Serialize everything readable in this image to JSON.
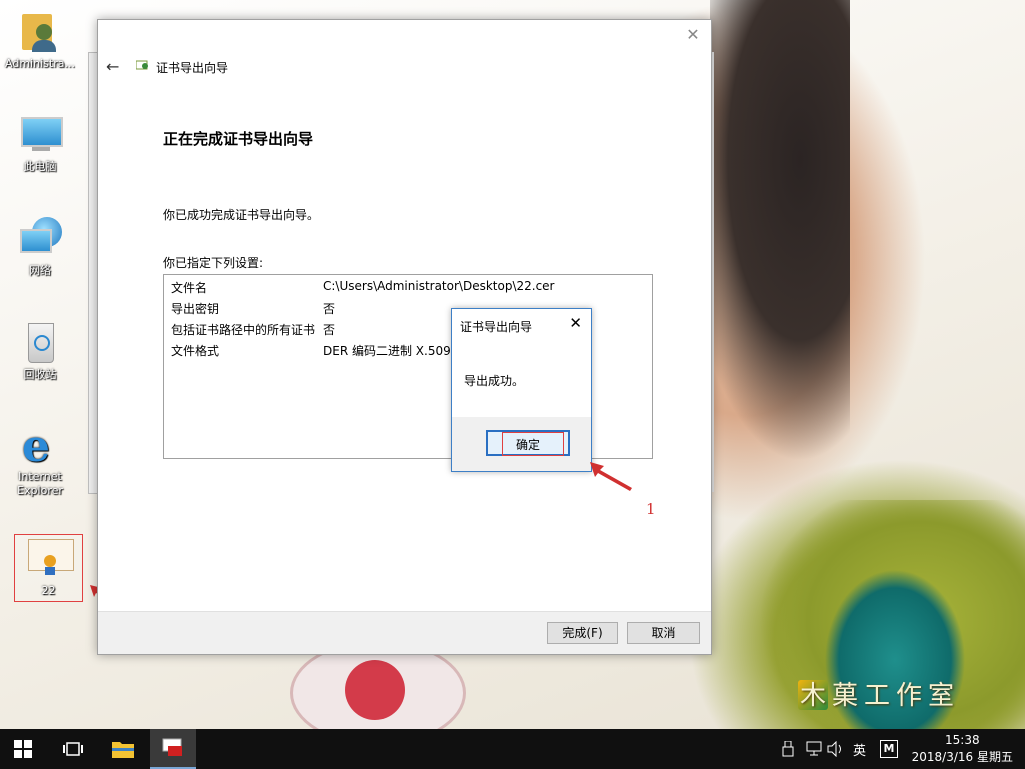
{
  "desktop": {
    "icons": [
      {
        "label": "Administra..."
      },
      {
        "label": "此电脑"
      },
      {
        "label": "网络"
      },
      {
        "label": "回收站"
      },
      {
        "label": "Internet Explorer"
      },
      {
        "label": "22"
      }
    ],
    "watermark": "木菓工作室"
  },
  "wizard": {
    "window_title": "证书导出向导",
    "heading": "正在完成证书导出向导",
    "success_message": "你已成功完成证书导出向导。",
    "settings_label": "你已指定下列设置:",
    "settings": [
      {
        "key": "文件名",
        "value": "C:\\Users\\Administrator\\Desktop\\22.cer"
      },
      {
        "key": "导出密钥",
        "value": "否"
      },
      {
        "key": "包括证书路径中的所有证书",
        "value": "否"
      },
      {
        "key": "文件格式",
        "value": "DER 编码二进制 X.509"
      }
    ],
    "finish_label": "完成(F)",
    "cancel_label": "取消"
  },
  "popup": {
    "title": "证书导出向导",
    "message": "导出成功。",
    "ok_label": "确定"
  },
  "annotation": {
    "number": "1",
    "color": "#d03030"
  },
  "taskbar": {
    "ime_label": "英",
    "time": "15:38",
    "date": "2018/3/16 星期五"
  }
}
